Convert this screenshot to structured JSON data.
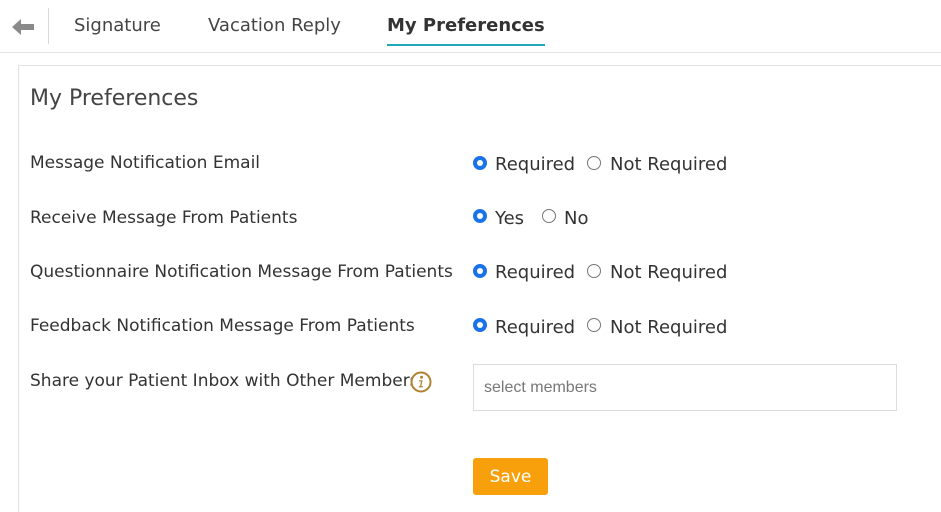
{
  "tabs": [
    {
      "label": "Signature"
    },
    {
      "label": "Vacation Reply"
    },
    {
      "label": "My Preferences",
      "active": true
    }
  ],
  "panel": {
    "title": "My Preferences"
  },
  "preferences": [
    {
      "label": "Message Notification Email",
      "options": [
        "Required",
        "Not Required"
      ],
      "selected": "Required"
    },
    {
      "label": "Receive Message From Patients",
      "options": [
        "Yes",
        "No"
      ],
      "selected": "Yes"
    },
    {
      "label": "Questionnaire Notification Message From Patients",
      "options": [
        "Required",
        "Not Required"
      ],
      "selected": "Required"
    },
    {
      "label": "Feedback Notification Message From Patients",
      "options": [
        "Required",
        "Not Required"
      ],
      "selected": "Required"
    }
  ],
  "share": {
    "label": "Share your Patient Inbox with Other Members",
    "placeholder": "select members",
    "value": "",
    "info_icon": "info-icon"
  },
  "save_label": "Save",
  "colors": {
    "accent_underline": "#1ea7b6",
    "radio_selected": "#1a73e8",
    "save_button": "#f8a00c",
    "info_icon": "#b0812f"
  }
}
